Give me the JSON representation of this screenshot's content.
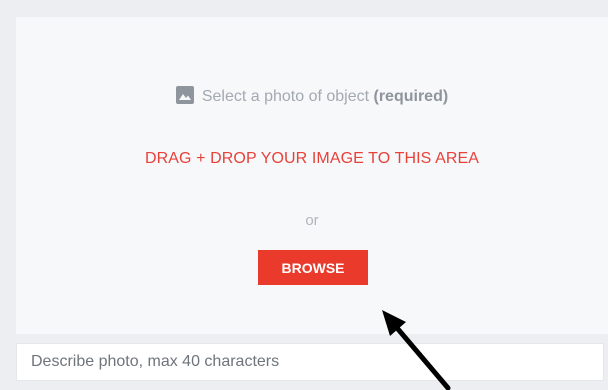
{
  "upload": {
    "icon": "image-icon",
    "select_prefix": "Select a photo of object ",
    "select_required": "(required)",
    "drag_text": "DRAG + DROP YOUR IMAGE TO THIS AREA",
    "or_text": "or",
    "browse_label": "BROWSE"
  },
  "description": {
    "placeholder": "Describe photo, max 40 characters",
    "value": ""
  },
  "annotation": {
    "icon": "pointer-arrow-icon"
  },
  "colors": {
    "accent": "#ea3a2b",
    "drag_text": "#e8413a",
    "dropzone_bg": "#f7f8fa",
    "outer_bg": "#eceef1"
  }
}
